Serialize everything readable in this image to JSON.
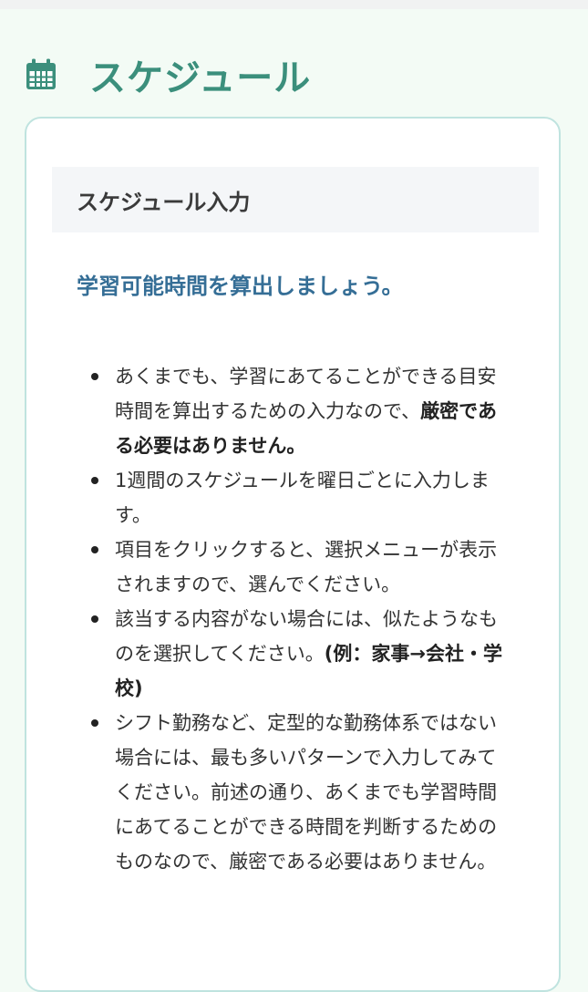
{
  "header": {
    "icon": "calendar-icon",
    "title": "スケジュール",
    "accent_color": "#3b8f7c"
  },
  "card": {
    "header_title": "スケジュール入力",
    "lead": "学習可能時間を算出しましょう。",
    "lead_color": "#356e96",
    "notes": [
      {
        "text": "あくまでも、学習にあてることができる目安時間を算出するための入力なので、",
        "bold": "厳密である必要はありません。"
      },
      {
        "text": "1週間のスケジュールを曜日ごとに入力します。"
      },
      {
        "text": "項目をクリックすると、選択メニューが表示されますので、選んでください。"
      },
      {
        "text": "該当する内容がない場合には、似たようなものを選択してください。",
        "bold": "(例：家事→会社・学校)"
      },
      {
        "text": "シフト勤務など、定型的な勤務体系ではない場合には、最も多いパターンで入力してみてください。前述の通り、あくまでも学習時間にあてることができる時間を判断するためのものなので、厳密である必要はありません。"
      }
    ]
  }
}
